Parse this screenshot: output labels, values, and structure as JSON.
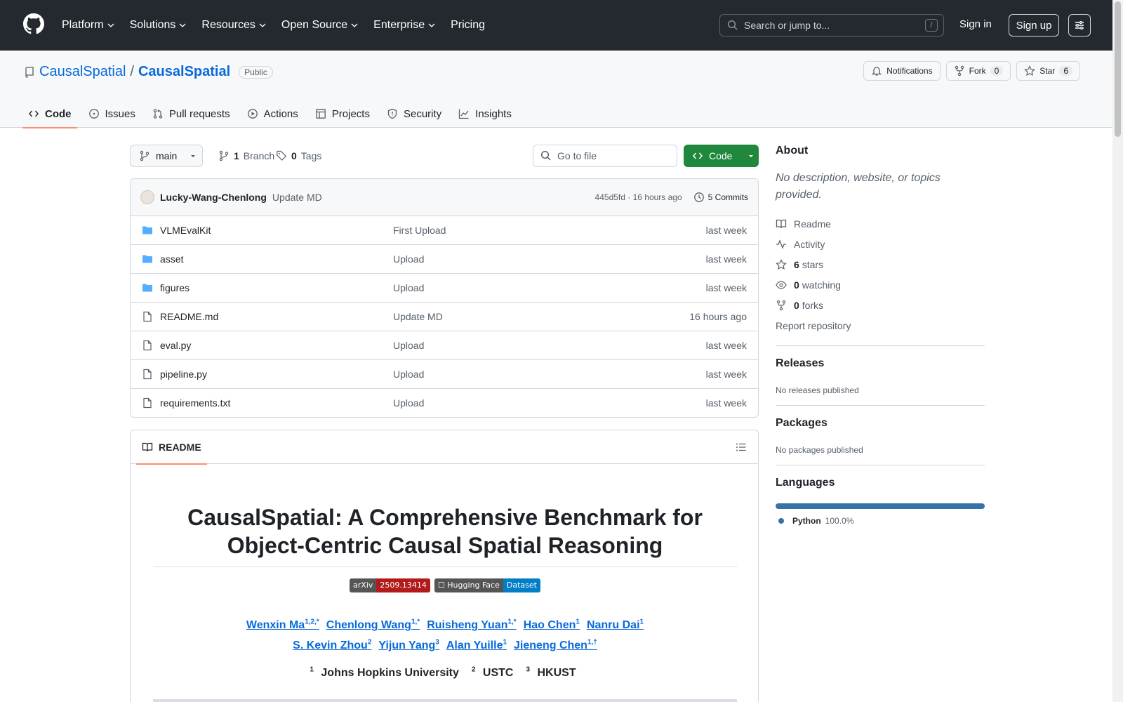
{
  "topnav": {
    "items": [
      "Platform",
      "Solutions",
      "Resources",
      "Open Source",
      "Enterprise",
      "Pricing"
    ],
    "search_placeholder": "Search or jump to...",
    "search_shortcut": "/",
    "signin": "Sign in",
    "signup": "Sign up"
  },
  "repo": {
    "owner": "CausalSpatial",
    "separator": "/",
    "name": "CausalSpatial",
    "visibility": "Public",
    "notifications": "Notifications",
    "fork_label": "Fork",
    "fork_count": "0",
    "star_label": "Star",
    "star_count": "6"
  },
  "tabs": [
    "Code",
    "Issues",
    "Pull requests",
    "Actions",
    "Projects",
    "Security",
    "Insights"
  ],
  "toolbar": {
    "branch": "main",
    "branch_count": "1",
    "branch_label": "Branch",
    "tag_count": "0",
    "tag_label": "Tags",
    "go_to_file": "Go to file",
    "code_button": "Code"
  },
  "commit": {
    "author": "Lucky-Wang-Chenlong",
    "message": "Update MD",
    "hash_time": "445d5fd · 16 hours ago",
    "commits": "5 Commits"
  },
  "files": [
    {
      "name": "VLMEvalKit",
      "type": "dir",
      "message": "First Upload",
      "time": "last week"
    },
    {
      "name": "asset",
      "type": "dir",
      "message": "Upload",
      "time": "last week"
    },
    {
      "name": "figures",
      "type": "dir",
      "message": "Upload",
      "time": "last week"
    },
    {
      "name": "README.md",
      "type": "file",
      "message": "Update MD",
      "time": "16 hours ago"
    },
    {
      "name": "eval.py",
      "type": "file",
      "message": "Upload",
      "time": "last week"
    },
    {
      "name": "pipeline.py",
      "type": "file",
      "message": "Upload",
      "time": "last week"
    },
    {
      "name": "requirements.txt",
      "type": "file",
      "message": "Upload",
      "time": "last week"
    }
  ],
  "readme": {
    "tab": "README",
    "title_line1": "CausalSpatial: A Comprehensive Benchmark for",
    "title_line2": "Object-Centric Causal Spatial Reasoning",
    "shields": [
      {
        "left": "arXiv",
        "right": "2509.13414",
        "left_color": "#555555",
        "right_color": "#b31b1b"
      },
      {
        "left": "☐ Hugging Face",
        "right": "Dataset",
        "left_color": "#555555",
        "right_color": "#007ec6"
      }
    ],
    "authors_line1": [
      {
        "name": "Wenxin Ma",
        "sup": "1,2,*"
      },
      {
        "name": "Chenlong Wang",
        "sup": "1,*"
      },
      {
        "name": "Ruisheng Yuan",
        "sup": "1,*"
      },
      {
        "name": "Hao Chen",
        "sup": "1"
      },
      {
        "name": "Nanru Dai",
        "sup": "1"
      }
    ],
    "authors_line2": [
      {
        "name": "S. Kevin Zhou",
        "sup": "2"
      },
      {
        "name": "Yijun Yang",
        "sup": "3"
      },
      {
        "name": "Alan Yuille",
        "sup": "1"
      },
      {
        "name": "Jieneng Chen",
        "sup": "1,†"
      }
    ],
    "affiliations": [
      {
        "sup": "1",
        "name": "Johns Hopkins University"
      },
      {
        "sup": "2",
        "name": "USTC"
      },
      {
        "sup": "3",
        "name": "HKUST"
      }
    ]
  },
  "sidebar": {
    "about_title": "About",
    "about_desc": "No description, website, or topics provided.",
    "readme": "Readme",
    "activity": "Activity",
    "stars_count": "6",
    "stars_label": "stars",
    "watching_count": "0",
    "watching_label": "watching",
    "forks_count": "0",
    "forks_label": "forks",
    "report": "Report repository",
    "releases_title": "Releases",
    "releases_text": "No releases published",
    "packages_title": "Packages",
    "packages_text": "No packages published",
    "languages_title": "Languages",
    "language_name": "Python",
    "language_pct": "100.0%",
    "language_color": "#3572a5"
  }
}
